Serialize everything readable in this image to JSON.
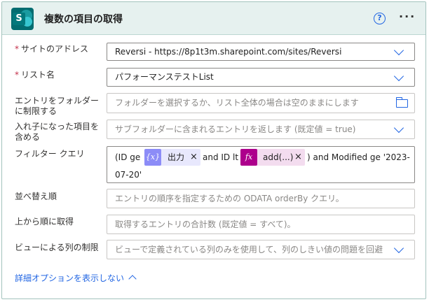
{
  "header": {
    "app_icon": "sharepoint-logo",
    "logo_letter": "S",
    "title": "複数の項目の取得",
    "help_icon": "question-circle-icon",
    "help_glyph": "?",
    "more_icon": "ellipsis-icon",
    "more_glyph": "···"
  },
  "required_marker": "*",
  "fields": {
    "site_address": {
      "label": "サイトのアドレス",
      "required": true,
      "value": "Reversi - https://8p1t3m.sharepoint.com/sites/Reversi"
    },
    "list_name": {
      "label": "リスト名",
      "required": true,
      "value": "パフォーマンステストList"
    },
    "folder": {
      "label_line1": "エントリをフォルダー",
      "label_line2": "に制限する",
      "placeholder": "フォルダーを選択するか、リスト全体の場合は空のままにします"
    },
    "nested": {
      "label_line1": "入れ子になった項目を",
      "label_line2": "含める",
      "placeholder": "サブフォルダーに含まれるエントリを返します (既定値 = true)"
    },
    "filter_query": {
      "label": "フィルター クエリ",
      "text_before": "(ID ge",
      "token1": {
        "icon": "{x}",
        "label": "出力",
        "close": "×",
        "color": "#8c8cf7"
      },
      "text_middle": "and ID lt",
      "token2": {
        "icon": "fx",
        "label": "add(...)",
        "close": "×",
        "color": "#ad008c"
      },
      "text_after": ") and Modified ge '2023-",
      "text_line2": "07-20'"
    },
    "order_by": {
      "label": "並べ替え順",
      "placeholder": "エントリの順序を指定するための ODATA orderBy クエリ。"
    },
    "top_count": {
      "label": "上から順に取得",
      "placeholder": "取得するエントリの合計数 (既定値 = すべて)。"
    },
    "view": {
      "label": "ビューによる列の制限",
      "placeholder": "ビューで定義されている列のみを使用して、列のしきい値の問題を回避"
    }
  },
  "advanced_toggle": "詳細オプションを表示しない",
  "colors": {
    "accent": "#2266e3",
    "header_bg": "#e6f1ef",
    "required": "#c4314b",
    "sharepoint": "#036c70"
  }
}
